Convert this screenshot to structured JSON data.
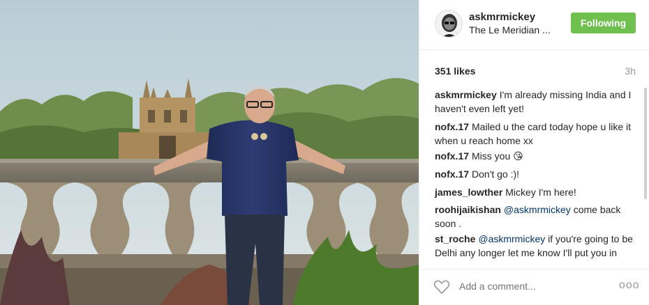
{
  "post": {
    "username": "askmrmickey",
    "location": "The Le Meridian ...",
    "follow_label": "Following",
    "likes": "351 likes",
    "age": "3h"
  },
  "comments": [
    {
      "user": "askmrmickey",
      "text": "I'm already missing India and I haven't even left yet!"
    },
    {
      "user": "nofx.17",
      "text": "Mailed u the card today hope u like it when u reach home xx"
    },
    {
      "user": "nofx.17",
      "text": "Miss you",
      "emoji": "😘"
    },
    {
      "user": "nofx.17",
      "text": "Don't go :)!"
    },
    {
      "user": "james_lowther",
      "text": "Mickey I'm here!"
    },
    {
      "user": "roohijaikishan",
      "mention": "@askmrmickey",
      "text": "come back soon ."
    },
    {
      "user": "st_roche",
      "mention": "@askmrmickey",
      "text": "if you're going to be Delhi any longer let me know I'll put you in touch with Ellie who lives there!"
    }
  ],
  "footer": {
    "comment_placeholder": "Add a comment...",
    "more_label": "ooo"
  },
  "icons": {
    "like": "heart-outline-icon",
    "more": "ellipsis-icon"
  },
  "colors": {
    "follow_button": "#70c050",
    "mention": "#003569",
    "muted": "#999999"
  }
}
